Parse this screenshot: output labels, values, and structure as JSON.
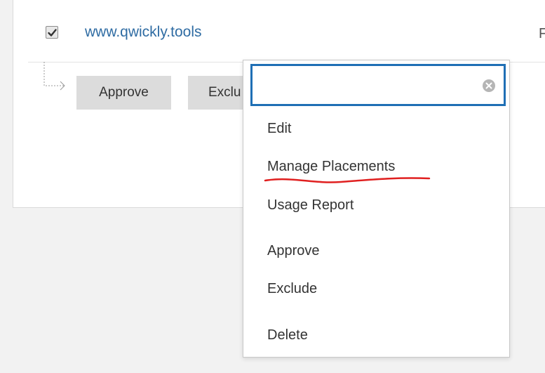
{
  "tool": {
    "checked": true,
    "link_text": "www.qwickly.tools",
    "right_text": "F"
  },
  "actions": {
    "approve_label": "Approve",
    "exclude_label_truncated": "Exclu"
  },
  "dropdown": {
    "search": {
      "value": "",
      "placeholder": ""
    },
    "items": [
      {
        "label": "Edit"
      },
      {
        "label": "Manage Placements"
      },
      {
        "label": "Usage Report"
      },
      {
        "label": "Approve"
      },
      {
        "label": "Exclude"
      },
      {
        "label": "Delete"
      }
    ],
    "focus_color": "#1f6fb5"
  },
  "colors": {
    "link": "#2f6ca3",
    "annotation_underline": "#e02020",
    "button_bg": "#dcdcdc",
    "page_bg": "#f2f2f2"
  },
  "icons": {
    "checkbox": "check-icon",
    "clear": "clear-circle-x-icon",
    "tree": "tree-connector-arrow-icon"
  }
}
